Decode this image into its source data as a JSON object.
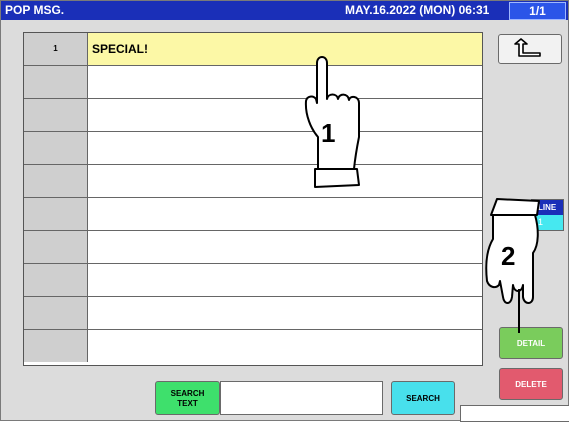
{
  "titlebar": {
    "title": "POP MSG.",
    "datetime": "MAY.16.2022 (MON) 06:31",
    "page": "1/1"
  },
  "list": {
    "rows": [
      {
        "num": "1",
        "text": "SPECIAL!",
        "selected": true
      },
      {
        "num": "",
        "text": ""
      },
      {
        "num": "",
        "text": ""
      },
      {
        "num": "",
        "text": ""
      },
      {
        "num": "",
        "text": ""
      },
      {
        "num": "",
        "text": ""
      },
      {
        "num": "",
        "text": ""
      },
      {
        "num": "",
        "text": ""
      },
      {
        "num": "",
        "text": ""
      },
      {
        "num": "",
        "text": ""
      }
    ]
  },
  "side": {
    "back_icon": "return-arrow-icon",
    "line_label": "LINE",
    "line_value": "1",
    "detail_label": "DETAIL",
    "delete_label": "DELETE"
  },
  "search": {
    "label_line1": "SEARCH",
    "label_line2": "TEXT",
    "value": "",
    "button_label": "SEARCH"
  },
  "callouts": {
    "first": "1",
    "second": "2",
    "icon": "pointing-hand-icon"
  },
  "colors": {
    "titlebar": "#1a2fb8",
    "selected_row": "#fcf8a6",
    "detail": "#7acc5c",
    "delete": "#e25a6e",
    "search_text": "#3ee06c",
    "search_button": "#48e0ec"
  }
}
